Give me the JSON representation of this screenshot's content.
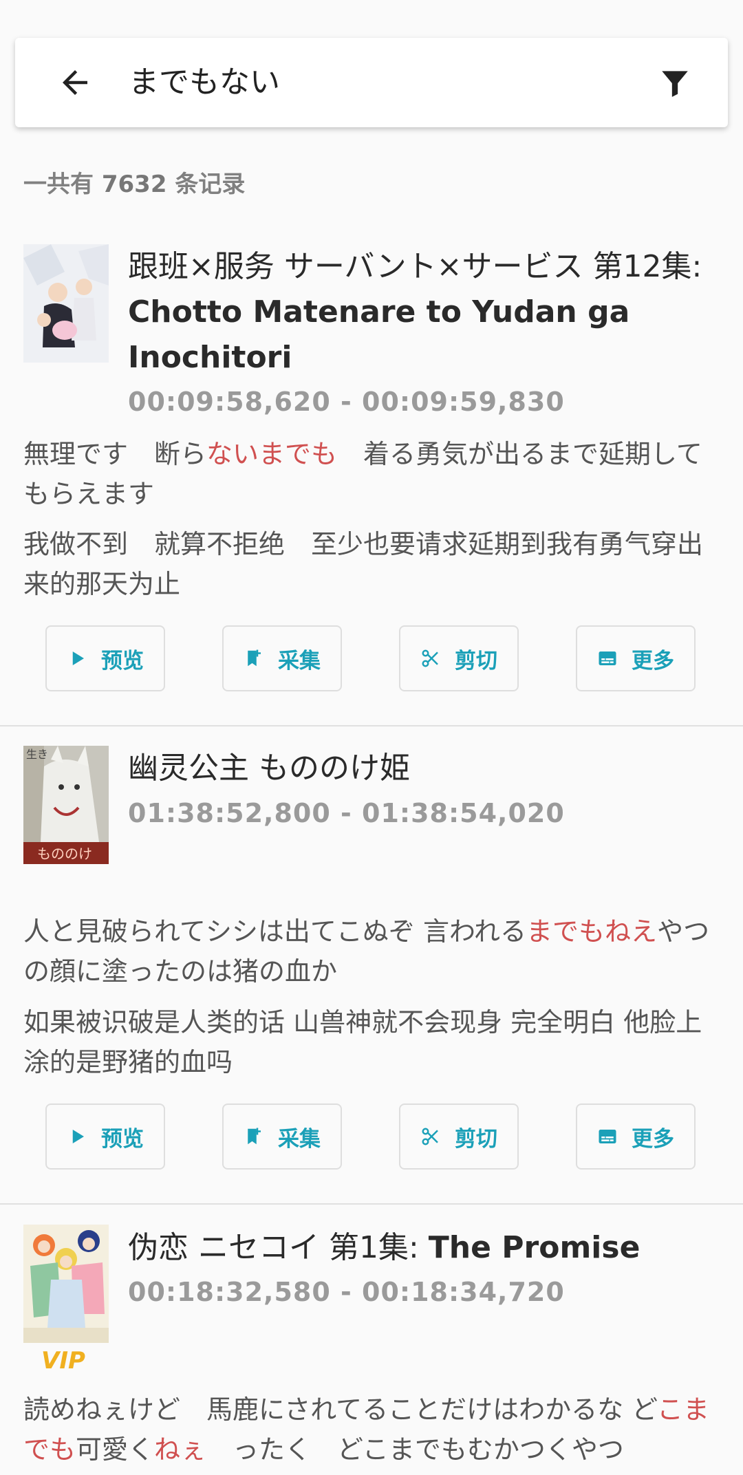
{
  "search": {
    "query": "までもない"
  },
  "count": {
    "prefix": "一共有",
    "number": "7632",
    "suffix": "条记录"
  },
  "buttons": {
    "preview": "预览",
    "collect": "采集",
    "cut": "剪切",
    "more": "更多"
  },
  "colors": {
    "accent": "#1ba0b8",
    "highlight": "#d05050",
    "vip": "#f0b020"
  },
  "results": [
    {
      "title_cjk": "跟班×服务 サーバント×サービス 第12集: ",
      "title_latin": "Chotto Matenare to Yudan ga Inochitori",
      "time": "00:09:58,620 - 00:09:59,830",
      "jp_pre": "無理です　断ら",
      "jp_hl": "ないまでも",
      "jp_post": "　着る勇気が出るまで延期してもらえます",
      "zh": "我做不到　就算不拒绝　至少也要请求延期到我有勇气穿出来的那天为止"
    },
    {
      "title_cjk": "幽灵公主 もののけ姫",
      "title_latin": "",
      "time": "01:38:52,800 - 01:38:54,020",
      "jp_pre": "人と見破られてシシは出てこぬぞ 言われる",
      "jp_hl": "までもねえ",
      "jp_post": "やつの顔に塗ったのは猪の血か",
      "zh": "如果被识破是人类的话 山兽神就不会现身 完全明白 他脸上涂的是野猪的血吗"
    },
    {
      "title_cjk": "伪恋 ニセコイ 第1集: ",
      "title_latin": "The Promise",
      "time": "00:18:32,580 - 00:18:34,720",
      "badge": "VIP",
      "jp_pre": "読めねぇけど　馬鹿にされてることだけはわかるな ど",
      "jp_hl": "こまでも",
      "jp_mid": "可愛く",
      "jp_hl2": "ねぇ",
      "jp_post": "　ったく　どこまでもむかつくやつ"
    }
  ]
}
